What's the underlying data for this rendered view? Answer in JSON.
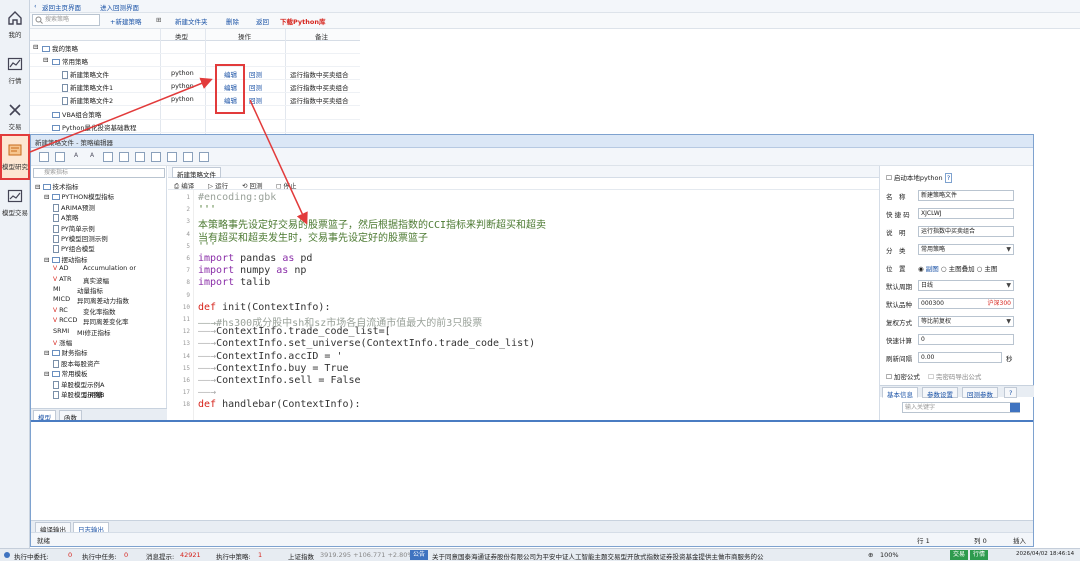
{
  "nav": {
    "items": [
      {
        "label": "我的",
        "icon": "home-icon"
      },
      {
        "label": "行情",
        "icon": "chart-icon"
      },
      {
        "label": "交易",
        "icon": "trade-icon"
      },
      {
        "label": "模型研究",
        "icon": "research-icon"
      },
      {
        "label": "模型交易",
        "icon": "model-trade-icon"
      }
    ]
  },
  "topbar": {
    "back_main": "返回主页界面",
    "enter_backtest": "进入回测界面"
  },
  "toolbar": {
    "search_placeholder": "搜索策略",
    "new_strategy": "+新建策略",
    "new_folder": "新建文件夹",
    "delete": "删除",
    "back": "返回",
    "download_python": "下载Python库"
  },
  "table": {
    "headers": [
      "类型",
      "操作",
      "备注"
    ],
    "root_folder": "我的策略",
    "sub_folder": "常用策略",
    "rows": [
      {
        "name": "新建策略文件",
        "type": "python",
        "edit": "编辑",
        "backtest": "回测",
        "note": "运行指数中买卖组合"
      },
      {
        "name": "新建策略文件1",
        "type": "python",
        "edit": "编辑",
        "backtest": "回测",
        "note": "运行指数中买卖组合"
      },
      {
        "name": "新建策略文件2",
        "type": "python",
        "edit": "编辑",
        "backtest": "回测",
        "note": "运行指数中买卖组合"
      }
    ],
    "vba_folder": "VBA组合策略",
    "python_folder": "Python量化投资基础教程"
  },
  "editor": {
    "title": "新建策略文件 - 策略编辑器",
    "tree_search": "搜索指标",
    "tree": [
      {
        "text": "技术指标",
        "level": 0,
        "kind": "folder"
      },
      {
        "text": "PYTHON模型指标",
        "level": 1,
        "kind": "folder"
      },
      {
        "text": "ARIMA预测",
        "level": 2,
        "kind": "file"
      },
      {
        "text": "A策略",
        "level": 2,
        "kind": "file"
      },
      {
        "text": "PY简单示例",
        "level": 2,
        "kind": "file"
      },
      {
        "text": "PY模型回测示例",
        "level": 2,
        "kind": "file"
      },
      {
        "text": "PY组合模型",
        "level": 2,
        "kind": "file"
      },
      {
        "text": "摆动指标",
        "level": 1,
        "kind": "folder"
      },
      {
        "text": "AD",
        "desc": "Accumulation or",
        "level": 2,
        "kind": "v"
      },
      {
        "text": "ATR",
        "desc": "真实波幅",
        "level": 2,
        "kind": "v"
      },
      {
        "text": "MI",
        "desc": "动量指标",
        "level": 2,
        "kind": "plain"
      },
      {
        "text": "MICD",
        "desc": "异同离差动力指数",
        "level": 2,
        "kind": "plain"
      },
      {
        "text": "RC",
        "desc": "变化率指数",
        "level": 2,
        "kind": "v"
      },
      {
        "text": "RCCD",
        "desc": "异同离差变化率",
        "level": 2,
        "kind": "v"
      },
      {
        "text": "SRMI",
        "desc": "MI修正指标",
        "level": 2,
        "kind": "plain"
      },
      {
        "text": "涨幅",
        "level": 2,
        "kind": "v"
      },
      {
        "text": "财务指标",
        "level": 1,
        "kind": "folder"
      },
      {
        "text": "股本每股资产",
        "level": 2,
        "kind": "file"
      },
      {
        "text": "常用模板",
        "level": 1,
        "kind": "folder"
      },
      {
        "text": "单股模型示例A",
        "level": 2,
        "kind": "file"
      },
      {
        "text": "单股模型示例B",
        "desc": "引用糖",
        "level": 2,
        "kind": "file"
      }
    ],
    "tree_tabs": [
      "模型",
      "函数"
    ],
    "file_tab": "新建策略文件",
    "code_tools": [
      "编译",
      "运行",
      "回测",
      "停止"
    ],
    "code_lines": [
      {
        "n": "1",
        "text": "#encoding:gbk",
        "cls": "c-com"
      },
      {
        "n": "2",
        "text": "'''",
        "cls": "c-str"
      },
      {
        "n": "3",
        "text": "本策略事先设定好交易的股票篮子，然后根据指数的CCI指标来判断超买和超卖",
        "cls": "c-str"
      },
      {
        "n": "4",
        "text": "当有超买和超卖发生时，交易事先设定好的股票篮子",
        "cls": "c-str"
      },
      {
        "n": "5",
        "text": "'''",
        "cls": "c-str"
      },
      {
        "n": "6",
        "text": "import pandas as pd",
        "cls": ""
      },
      {
        "n": "7",
        "text": "import numpy as np",
        "cls": ""
      },
      {
        "n": "8",
        "text": "import talib",
        "cls": ""
      },
      {
        "n": "9",
        "text": "",
        "cls": ""
      },
      {
        "n": "10",
        "text": "def init(ContextInfo):",
        "cls": ""
      },
      {
        "n": "11",
        "text": "——→#hs300成分股中sh和sz市场各自流通市值最大的前3只股票",
        "cls": "c-com"
      },
      {
        "n": "12",
        "text": "——→ContextInfo.trade_code_list=[",
        "cls": ""
      },
      {
        "n": "13",
        "text": "——→ContextInfo.set_universe(ContextInfo.trade_code_list)",
        "cls": ""
      },
      {
        "n": "14",
        "text": "——→ContextInfo.accID = '",
        "cls": ""
      },
      {
        "n": "15",
        "text": "——→ContextInfo.buy = True",
        "cls": ""
      },
      {
        "n": "16",
        "text": "——→ContextInfo.sell = False",
        "cls": ""
      },
      {
        "n": "17",
        "text": "——→",
        "cls": ""
      },
      {
        "n": "18",
        "text": "def handlebar(ContextInfo):",
        "cls": ""
      }
    ],
    "props": {
      "enable_local_python": "启动本地python",
      "name_label": "名　称",
      "name_value": "新建策略文件",
      "code_label": "快 捷 码",
      "code_value": "XJCLWJ",
      "desc_label": "说　明",
      "desc_value": "运行指数中买卖组合",
      "cat_label": "分　类",
      "cat_value": "常用策略",
      "pos_label": "位　置",
      "pos_options": [
        "副图",
        "主图叠加",
        "主图"
      ],
      "period_label": "默认周期",
      "period_value": "日线",
      "stock_label": "默认品种",
      "stock_value": "000300",
      "stock_name": "沪深300",
      "adj_label": "复权方式",
      "adj_value": "等比前复权",
      "calc_label": "快速计算",
      "calc_value": "0",
      "refresh_label": "刷新间隔",
      "refresh_value": "0.00",
      "refresh_unit": "秒",
      "encrypt": "加密公式",
      "allow_export": "完密码导出公式",
      "tabs": [
        "基本信息",
        "参数设置",
        "回测参数"
      ],
      "search_placeholder": "输入关键字"
    },
    "out_tabs": [
      "编译输出",
      "日志输出"
    ],
    "status_left": "就绪",
    "status_row": "行 1",
    "status_col": "列 0",
    "status_mode": "插入"
  },
  "statusbar": {
    "entrust_label": "执行中委托:",
    "entrust_val": "0",
    "task_label": "执行中任务:",
    "task_val": "0",
    "msg_label": "消息提示:",
    "msg_val": "42921",
    "strategy_label": "执行中策略:",
    "strategy_val": "1",
    "index_label": "上证指数",
    "index_vals": "3919.295  +106.771  +2.80%",
    "notice_badge": "公告",
    "notice": "关于同意国泰海通证券股份有限公司为平安中证人工智能主题交易型开放式指数证券投资基金提供主做市商服务的公",
    "zoom": "100%",
    "trade_badge": "交易",
    "quote_badge": "行情",
    "datetime": "2026/04/02 18:46:14"
  },
  "colors": {
    "accent": "#1a52a6",
    "alert": "#e23b3b",
    "panel_border": "#7ea2cf"
  }
}
